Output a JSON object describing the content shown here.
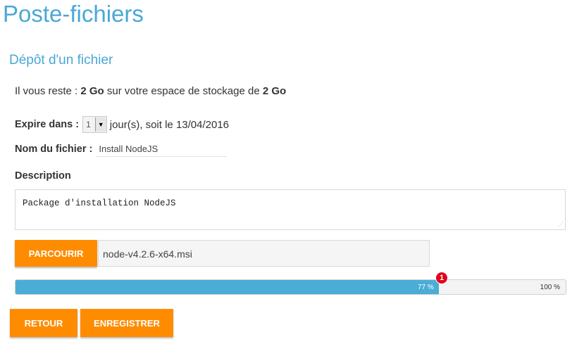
{
  "page": {
    "title": "Poste-fichiers"
  },
  "section": {
    "title": "Dépôt d'un fichier"
  },
  "storage": {
    "prefix": "Il vous reste : ",
    "remaining": "2 Go",
    "middle": " sur votre espace de stockage de ",
    "total": "2 Go"
  },
  "expire": {
    "label": "Expire dans :",
    "selected": "1",
    "suffix": "jour(s), soit le 13/04/2016"
  },
  "filename": {
    "label": "Nom du fichier :",
    "value": "Install NodeJS"
  },
  "description": {
    "label": "Description",
    "value": "Package d'installation NodeJS"
  },
  "browse": {
    "button": "PARCOURIR",
    "file": "node-v4.2.6-x64.msi"
  },
  "progress": {
    "percent": 77,
    "percent_label": "77 %",
    "total_label": "100 %",
    "marker": "1"
  },
  "actions": {
    "back": "RETOUR",
    "save": "ENREGISTRER"
  },
  "colors": {
    "accent": "#ff8c00",
    "title": "#4aa8d6",
    "progress": "#4aadd6",
    "marker": "#e3001b"
  }
}
